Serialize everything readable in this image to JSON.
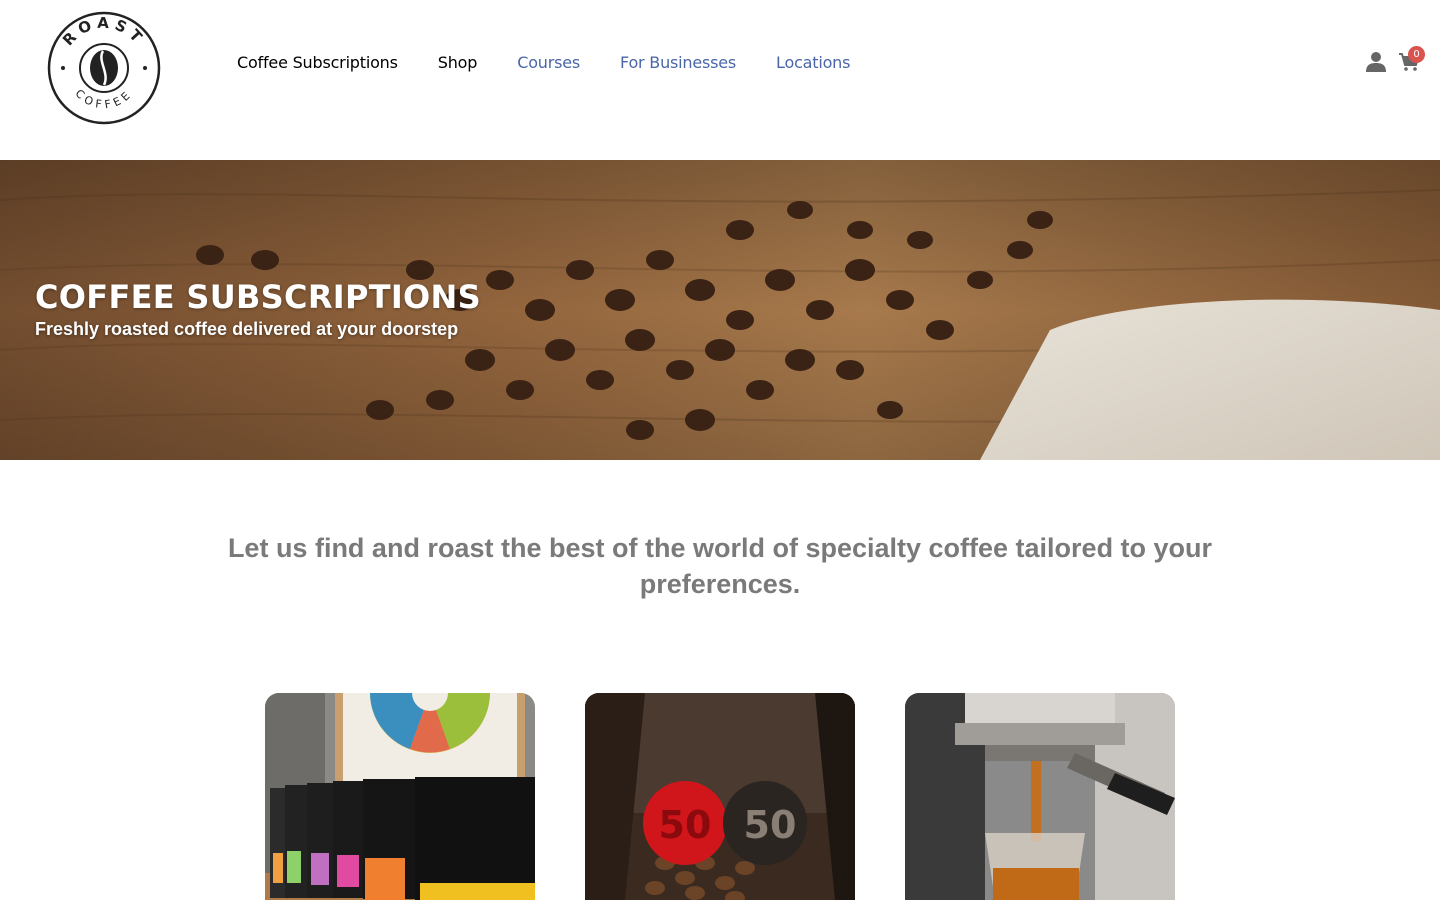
{
  "header": {
    "logo": {
      "top_text": "ROAST",
      "bottom_text": "COFFEE",
      "icon": "coffee-bean-icon"
    },
    "nav": [
      {
        "label": "Coffee Subscriptions",
        "style": "active"
      },
      {
        "label": "Shop",
        "style": "active"
      },
      {
        "label": "Courses",
        "style": "link"
      },
      {
        "label": "For Businesses",
        "style": "link"
      },
      {
        "label": "Locations",
        "style": "link"
      }
    ],
    "account_icon": "user-icon",
    "cart": {
      "icon": "cart-icon",
      "count": "0"
    }
  },
  "hero": {
    "title": "COFFEE SUBSCRIPTIONS",
    "subtitle": "Freshly roasted coffee delivered at your doorstep"
  },
  "intro": {
    "text": "Let us find and roast the best of the world of specialty coffee tailored to your preferences."
  },
  "cards": [
    {
      "image": "coffee-bags-and-flavor-wheel-photo"
    },
    {
      "image": "coffee-beans-with-5050-label-photo",
      "label": "50"
    },
    {
      "image": "espresso-extraction-photo"
    }
  ],
  "colors": {
    "nav_link_blue": "#4a66a8",
    "intro_text": "#7a7a7a",
    "cart_badge": "#d9534f"
  }
}
